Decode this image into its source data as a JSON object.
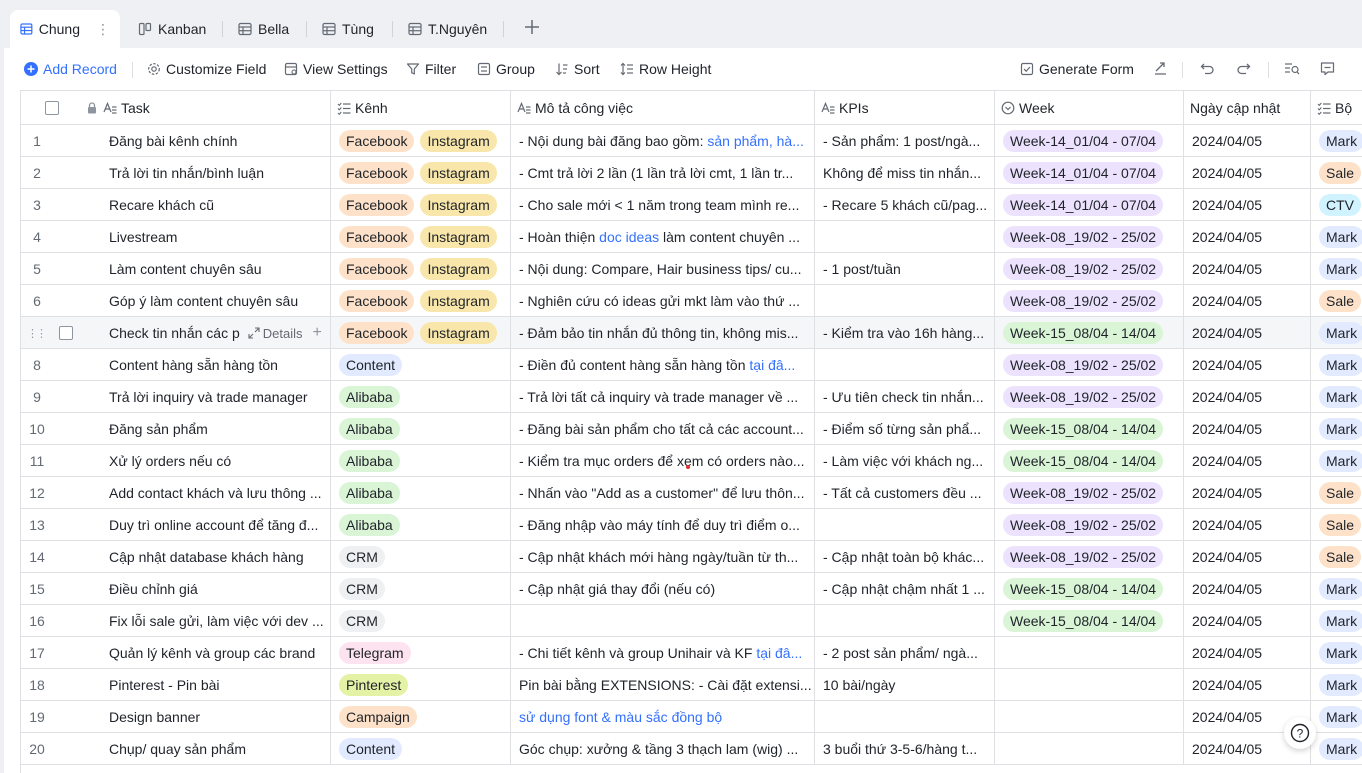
{
  "tabs": [
    {
      "label": "Chung",
      "active": true
    },
    {
      "label": "Kanban"
    },
    {
      "label": "Bella"
    },
    {
      "label": "Tùng"
    },
    {
      "label": "T.Nguyên"
    }
  ],
  "tab_more": "⋮",
  "toolbar": {
    "add_record": "Add Record",
    "customize_field": "Customize Field",
    "view_settings": "View Settings",
    "filter": "Filter",
    "group": "Group",
    "sort": "Sort",
    "row_height": "Row Height",
    "generate_form": "Generate Form"
  },
  "columns": {
    "task": "Task",
    "kenh": "Kênh",
    "mota": "Mô tả công việc",
    "kpis": "KPIs",
    "week": "Week",
    "date": "Ngày cập nhật",
    "bo": "Bộ"
  },
  "hover_row": {
    "details": "Details"
  },
  "rows": [
    {
      "n": "1",
      "task": "Đăng bài kênh chính",
      "tags": [
        "Facebook",
        "Instagram"
      ],
      "mota": "- Nội dung bài đăng bao gồm: ",
      "mota_link": "sản phẩm, hà...",
      "kpi": "- Sản phẩm: 1 post/ngà...",
      "week": "Week-14_01/04 - 07/04",
      "wc": "purple",
      "date": "2024/04/05",
      "bo": "Mark",
      "bc": "mark"
    },
    {
      "n": "2",
      "task": "Trả lời tin nhắn/bình luận",
      "tags": [
        "Facebook",
        "Instagram"
      ],
      "mota": "- Cmt trả lời 2 lần (1 lần trả lời cmt, 1 lần tr...",
      "mota_link": "",
      "kpi": "Không để miss tin nhắn...",
      "week": "Week-14_01/04 - 07/04",
      "wc": "purple",
      "date": "2024/04/05",
      "bo": "Sale",
      "bc": "sale"
    },
    {
      "n": "3",
      "task": "Recare khách cũ",
      "tags": [
        "Facebook",
        "Instagram"
      ],
      "mota": "- Cho sale mới < 1 năm trong team mình re...",
      "mota_link": "",
      "kpi": "- Recare 5 khách cũ/pag...",
      "week": "Week-14_01/04 - 07/04",
      "wc": "purple",
      "date": "2024/04/05",
      "bo": "CTV",
      "bc": "ctv"
    },
    {
      "n": "4",
      "task": "Livestream",
      "tags": [
        "Facebook",
        "Instagram"
      ],
      "mota": "- Hoàn thiện ",
      "mota_link": "doc ideas",
      "mota_after": " làm content chuyên ...",
      "kpi": "",
      "week": "Week-08_19/02 - 25/02",
      "wc": "purple",
      "date": "2024/04/05",
      "bo": "Mark",
      "bc": "mark"
    },
    {
      "n": "5",
      "task": "Làm content chuyên sâu",
      "tags": [
        "Facebook",
        "Instagram"
      ],
      "mota": "- Nội dung: Compare, Hair business tips/ cu...",
      "mota_link": "",
      "kpi": "- 1 post/tuần",
      "week": "Week-08_19/02 - 25/02",
      "wc": "purple",
      "date": "2024/04/05",
      "bo": "Mark",
      "bc": "mark"
    },
    {
      "n": "6",
      "task": "Góp ý làm content chuyên sâu",
      "tags": [
        "Facebook",
        "Instagram"
      ],
      "mota": "- Nghiên cứu có ideas gửi mkt làm vào thứ ...",
      "mota_link": "",
      "kpi": "",
      "week": "Week-08_19/02 - 25/02",
      "wc": "purple",
      "date": "2024/04/05",
      "bo": "Sale",
      "bc": "sale"
    },
    {
      "n": "",
      "task": "Check tin nhắn các p",
      "tags": [
        "Facebook",
        "Instagram"
      ],
      "mota": "- Đảm bảo tin nhắn đủ thông tin, không mis...",
      "mota_link": "",
      "kpi": "- Kiểm tra vào 16h hàng...",
      "week": "Week-15_08/04 - 14/04",
      "wc": "green",
      "date": "2024/04/05",
      "bo": "Mark",
      "bc": "mark",
      "hover": true
    },
    {
      "n": "8",
      "task": "Content hàng sẵn hàng tồn",
      "tags": [
        "Content"
      ],
      "mota": "- Điền đủ content hàng sẵn hàng tồn ",
      "mota_link": "tại đâ...",
      "kpi": "",
      "week": "Week-08_19/02 - 25/02",
      "wc": "purple",
      "date": "2024/04/05",
      "bo": "Mark",
      "bc": "mark"
    },
    {
      "n": "9",
      "task": "Trả lời inquiry và trade manager",
      "tags": [
        "Alibaba"
      ],
      "mota": "- Trả lời tất cả inquiry và trade manager về ...",
      "mota_link": "",
      "kpi": "- Ưu tiên check tin nhắn...",
      "week": "Week-08_19/02 - 25/02",
      "wc": "purple",
      "date": "2024/04/05",
      "bo": "Mark",
      "bc": "mark"
    },
    {
      "n": "10",
      "task": "Đăng sản phẩm",
      "tags": [
        "Alibaba"
      ],
      "mota": "- Đăng bài sản phẩm cho tất cả các account...",
      "mota_link": "",
      "kpi": "- Điểm số từng sản phẩ...",
      "week": "Week-15_08/04 - 14/04",
      "wc": "green",
      "date": "2024/04/05",
      "bo": "Mark",
      "bc": "mark"
    },
    {
      "n": "11",
      "task": "Xử lý orders nếu có",
      "tags": [
        "Alibaba"
      ],
      "mota": "- Kiểm tra mục orders để xem có orders nào...",
      "mota_link": "",
      "kpi": "- Làm việc với khách ng...",
      "week": "Week-15_08/04 - 14/04",
      "wc": "green",
      "date": "2024/04/05",
      "bo": "Mark",
      "bc": "mark"
    },
    {
      "n": "12",
      "task": "Add contact khách và lưu thông ...",
      "tags": [
        "Alibaba"
      ],
      "mota": "- Nhấn vào \"Add as a customer\" để lưu thôn...",
      "mota_link": "",
      "kpi": "- Tất cả customers đều ...",
      "week": "Week-08_19/02 - 25/02",
      "wc": "purple",
      "date": "2024/04/05",
      "bo": "Sale",
      "bc": "sale"
    },
    {
      "n": "13",
      "task": "Duy trì online account để tăng đ...",
      "tags": [
        "Alibaba"
      ],
      "mota": "- Đăng nhập vào máy tính để duy trì điểm o...",
      "mota_link": "",
      "kpi": "",
      "week": "Week-08_19/02 - 25/02",
      "wc": "purple",
      "date": "2024/04/05",
      "bo": "Sale",
      "bc": "sale"
    },
    {
      "n": "14",
      "task": "Cập nhật database khách hàng",
      "tags": [
        "CRM"
      ],
      "mota": "- Cập nhật khách mới hàng ngày/tuần từ th...",
      "mota_link": "",
      "kpi": "- Cập nhật toàn bộ khác...",
      "week": "Week-08_19/02 - 25/02",
      "wc": "purple",
      "date": "2024/04/05",
      "bo": "Sale",
      "bc": "sale"
    },
    {
      "n": "15",
      "task": "Điều chỉnh giá",
      "tags": [
        "CRM"
      ],
      "mota": "- Cập nhật giá thay đổi (nếu có)",
      "mota_link": "",
      "kpi": "- Cập nhật chậm nhất 1 ...",
      "week": "Week-15_08/04 - 14/04",
      "wc": "green",
      "date": "2024/04/05",
      "bo": "Mark",
      "bc": "mark"
    },
    {
      "n": "16",
      "task": "Fix lỗi sale gửi, làm việc với dev ...",
      "tags": [
        "CRM"
      ],
      "mota": "",
      "mota_link": "",
      "kpi": "",
      "week": "Week-15_08/04 - 14/04",
      "wc": "green",
      "date": "2024/04/05",
      "bo": "Mark",
      "bc": "mark"
    },
    {
      "n": "17",
      "task": "Quản lý kênh và group các brand",
      "tags": [
        "Telegram"
      ],
      "mota": "- Chi tiết kênh và group Unihair và KF ",
      "mota_link": "tại đâ...",
      "kpi": "- 2 post sản phẩm/ ngà...",
      "week": "",
      "wc": "",
      "date": "2024/04/05",
      "bo": "Mark",
      "bc": "mark"
    },
    {
      "n": "18",
      "task": "Pinterest - Pin bài",
      "tags": [
        "Pinterest"
      ],
      "mota": "Pin bài bằng EXTENSIONS: - Cài đặt extensi...",
      "mota_link": "",
      "kpi": "10 bài/ngày",
      "week": "",
      "wc": "",
      "date": "2024/04/05",
      "bo": "Mark",
      "bc": "mark"
    },
    {
      "n": "19",
      "task": "Design banner",
      "tags": [
        "Campaign"
      ],
      "mota": "",
      "mota_link": "sử dụng font & màu sắc đồng bộ",
      "kpi": "",
      "week": "",
      "wc": "",
      "date": "2024/04/05",
      "bo": "Mark",
      "bc": "mark"
    },
    {
      "n": "20",
      "task": "Chụp/ quay sản phẩm",
      "tags": [
        "Content"
      ],
      "mota": "Góc chụp: xưởng & tầng 3 thạch lam (wig) ...",
      "mota_link": "",
      "kpi": "3 buổi thứ 3-5-6/hàng t...",
      "week": "",
      "wc": "",
      "date": "2024/04/05",
      "bo": "Mark",
      "bc": "mark"
    }
  ],
  "help_label": "?"
}
